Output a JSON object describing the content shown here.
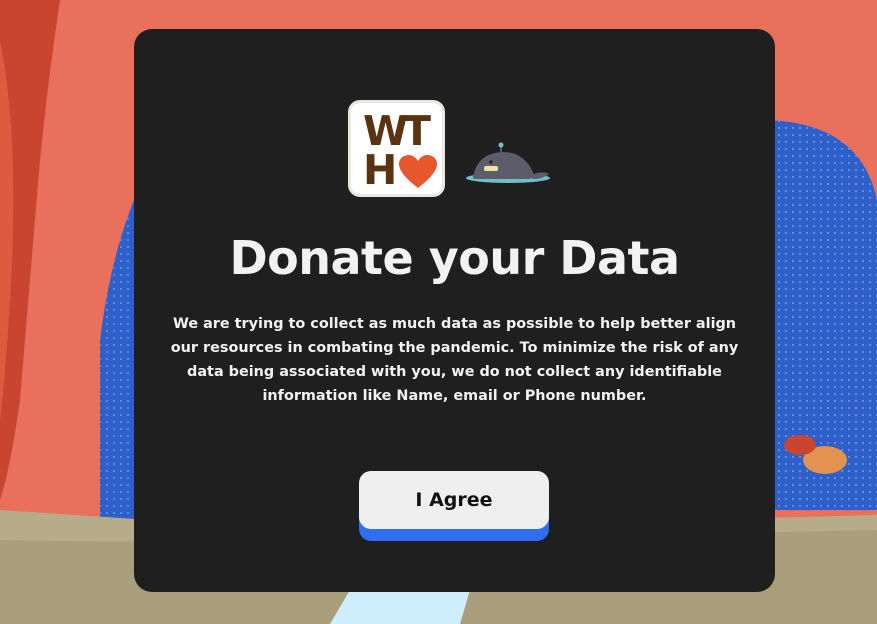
{
  "logo": {
    "letters": [
      "W",
      "T",
      "H"
    ],
    "heart_icon": "heart-icon",
    "brand_brown": "#5a3311",
    "heart_color": "#e8562e"
  },
  "mascot_icon": "whale-icon",
  "modal": {
    "title": "Donate your Data",
    "description": "We are trying to collect as much data as possible to help better align our resources in combating the pandemic. To minimize the risk of any data being associated with you, we do not collect any identifiable information like Name, email or Phone number.",
    "agree_label": "I Agree",
    "background_color": "#1f1f1f",
    "button_accent": "#2f6ef0"
  },
  "background": {
    "primary_color": "#e8705c",
    "arch_color": "#2f5fc8"
  }
}
